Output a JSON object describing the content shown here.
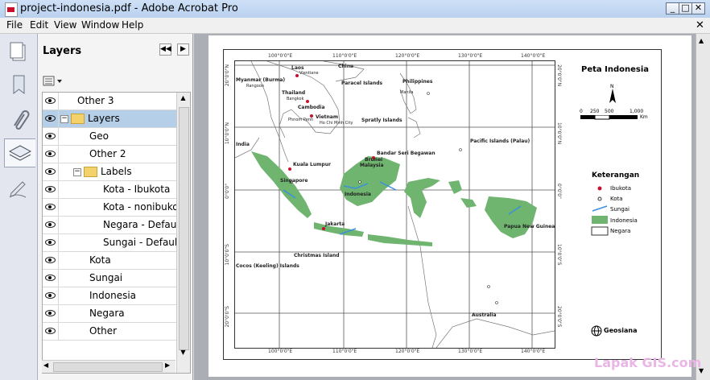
{
  "window": {
    "title": "project-indonesia.pdf - Adobe Acrobat Pro"
  },
  "menu": {
    "items": [
      "File",
      "Edit",
      "View",
      "Window",
      "Help"
    ]
  },
  "panel": {
    "title": "Layers"
  },
  "layers": [
    {
      "label": "Other 3",
      "indent": 0
    },
    {
      "label": "Layers",
      "indent": 0
    },
    {
      "label": "Geo",
      "indent": 1
    },
    {
      "label": "Other 2",
      "indent": 1
    },
    {
      "label": "Labels",
      "indent": 1
    },
    {
      "label": "Kota - Ibukota",
      "indent": 2
    },
    {
      "label": "Kota - nonibukota",
      "indent": 2
    },
    {
      "label": "Negara - Default",
      "indent": 2
    },
    {
      "label": "Sungai - Default",
      "indent": 2
    },
    {
      "label": "Kota",
      "indent": 1
    },
    {
      "label": "Sungai",
      "indent": 1
    },
    {
      "label": "Indonesia",
      "indent": 1
    },
    {
      "label": "Negara",
      "indent": 1
    },
    {
      "label": "Other",
      "indent": 1
    }
  ],
  "map": {
    "title": "Peta Indonesia",
    "scale": {
      "labels": [
        "0",
        "250",
        "500",
        "1,000"
      ],
      "unit": "Km"
    },
    "north": "N",
    "legend_title": "Keterangan",
    "legend": [
      "Ibukota",
      "Kota",
      "Sungai",
      "Indonesia",
      "Negara"
    ],
    "publisher": "Geosiana",
    "lon_ticks": [
      "100°0'0\"E",
      "110°0'0\"E",
      "120°0'0\"E",
      "130°0'0\"E",
      "140°0'0\"E"
    ],
    "lat_ticks": [
      "20°0'0\"N",
      "10°0'0\"N",
      "0°0'0\"",
      "10°0'0\"S",
      "20°0'0\"S"
    ],
    "place_labels": {
      "china": "China",
      "laos": "Laos",
      "vientiane": "Vientiane",
      "myanmar": "Myanmar (Burma)",
      "rangoon": "Rangoon",
      "paracel": "Paracel Islands",
      "philippines": "Philippines",
      "thailand": "Thailand",
      "bangkok": "Bangkok",
      "manila": "Manila",
      "cambodia": "Cambodia",
      "vietnam": "Vietnam",
      "phnom_penh": "Phnom Penh",
      "ho_chi_minh": "Ho Chi Minh City",
      "spratly": "Spratly Islands",
      "india": "India",
      "pacific": "Pacific Islands (Palau)",
      "bandar": "Bandar Seri Begawan",
      "brunei": "Brunei",
      "malaysia": "Malaysia",
      "kuala_lumpur": "Kuala Lumpur",
      "singapore": "Singapore",
      "indonesia": "Indonesia",
      "jakarta": "Jakarta",
      "png": "Papua New Guinea",
      "christmas": "Christmas Island",
      "cocos": "Cocos (Keeling) Islands",
      "australia": "Australia"
    }
  },
  "watermark": "Lapak GIS.com",
  "colors": {
    "land_indonesia": "#6fb56f",
    "river": "#3b8fe0",
    "capital": "#c8102e",
    "selection": "#b6cfe9"
  }
}
